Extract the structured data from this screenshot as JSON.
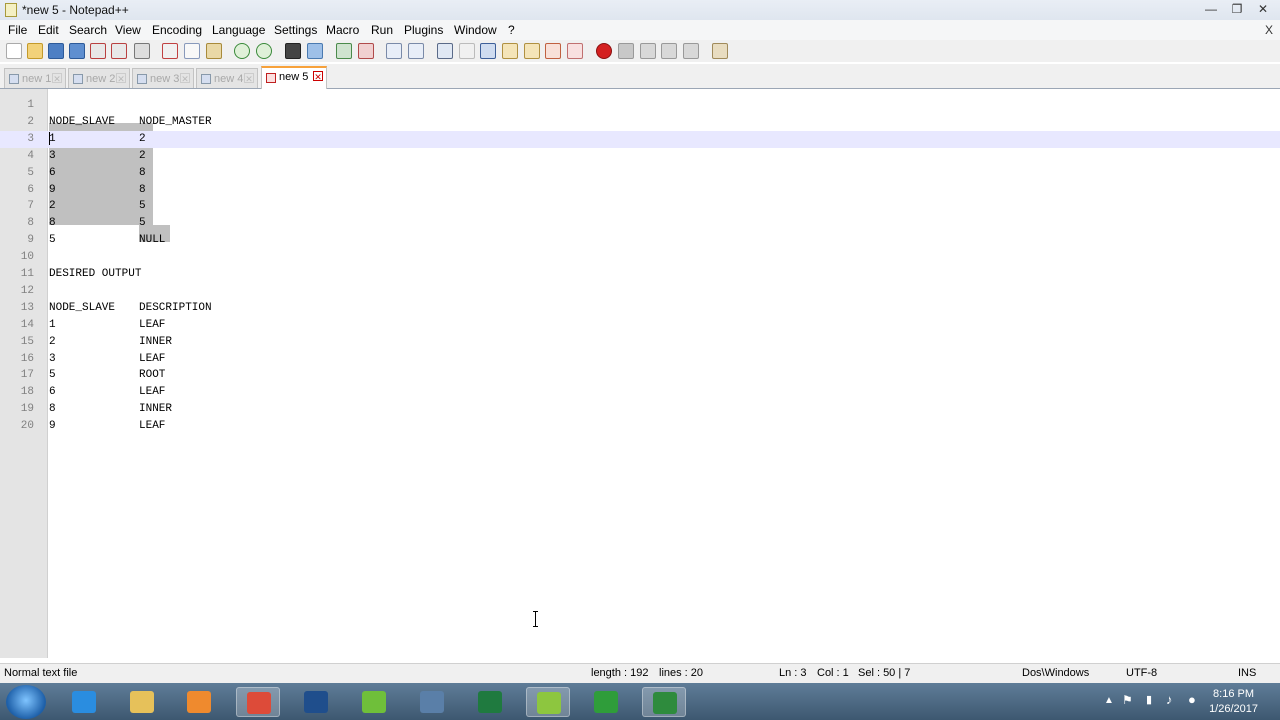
{
  "window": {
    "title": "*new 5 - Notepad++",
    "controls": [
      "—",
      "❐",
      "✕"
    ]
  },
  "menu": [
    "File",
    "Edit",
    "Search",
    "View",
    "Encoding",
    "Language",
    "Settings",
    "Macro",
    "Run",
    "Plugins",
    "Window",
    "?"
  ],
  "menu_close": "X",
  "tabs": [
    {
      "label": "new 1",
      "active": false
    },
    {
      "label": "new 2",
      "active": false
    },
    {
      "label": "new 3",
      "active": false
    },
    {
      "label": "new 4",
      "active": false
    },
    {
      "label": "new 5",
      "active": true
    }
  ],
  "editor": {
    "lines": [
      {
        "n": "1",
        "a": "",
        "b": ""
      },
      {
        "n": "2",
        "a": "NODE_SLAVE",
        "b": "NODE_MASTER"
      },
      {
        "n": "3",
        "a": "1",
        "b": "2"
      },
      {
        "n": "4",
        "a": "3",
        "b": "2"
      },
      {
        "n": "5",
        "a": "6",
        "b": "8"
      },
      {
        "n": "6",
        "a": "9",
        "b": "8"
      },
      {
        "n": "7",
        "a": "2",
        "b": "5"
      },
      {
        "n": "8",
        "a": "8",
        "b": "5"
      },
      {
        "n": "9",
        "a": "5",
        "b": "NULL"
      },
      {
        "n": "10",
        "a": "",
        "b": ""
      },
      {
        "n": "11",
        "a": "DESIRED OUTPUT",
        "b": ""
      },
      {
        "n": "12",
        "a": "",
        "b": ""
      },
      {
        "n": "13",
        "a": "NODE_SLAVE",
        "b": "DESCRIPTION"
      },
      {
        "n": "14",
        "a": "1",
        "b": "LEAF"
      },
      {
        "n": "15",
        "a": "2",
        "b": "INNER"
      },
      {
        "n": "16",
        "a": "3",
        "b": "LEAF"
      },
      {
        "n": "17",
        "a": "5",
        "b": "ROOT"
      },
      {
        "n": "18",
        "a": "6",
        "b": "LEAF"
      },
      {
        "n": "19",
        "a": "8",
        "b": "INNER"
      },
      {
        "n": "20",
        "a": "9",
        "b": "LEAF"
      }
    ]
  },
  "status": {
    "filetype": "Normal text file",
    "length": "length : 192",
    "lines": "lines : 20",
    "ln": "Ln : 3",
    "col": "Col : 1",
    "sel": "Sel : 50 | 7",
    "eol": "Dos\\Windows",
    "encoding": "UTF-8",
    "mode": "INS"
  },
  "taskbar": {
    "time": "8:16 PM",
    "date": "1/26/2017",
    "apps": [
      {
        "name": "internet-explorer-icon",
        "color": "#2a8de0",
        "active": false
      },
      {
        "name": "file-explorer-icon",
        "color": "#e6c15a",
        "active": false
      },
      {
        "name": "media-player-icon",
        "color": "#ef8a2e",
        "active": false
      },
      {
        "name": "chrome-icon",
        "color": "#dd4b39",
        "active": true
      },
      {
        "name": "photoshop-icon",
        "color": "#1f4e8c",
        "active": false
      },
      {
        "name": "utorrent-icon",
        "color": "#6fbf3a",
        "active": false
      },
      {
        "name": "video-app-icon",
        "color": "#5a7fa8",
        "active": false
      },
      {
        "name": "excel-icon",
        "color": "#1f7a3f",
        "active": false
      },
      {
        "name": "notepadpp-icon",
        "color": "#8dc63f",
        "active": true
      },
      {
        "name": "camtasia-icon",
        "color": "#2f9d3a",
        "active": false
      },
      {
        "name": "camtasia-recorder-icon",
        "color": "#2e8b3d",
        "active": true
      }
    ]
  }
}
